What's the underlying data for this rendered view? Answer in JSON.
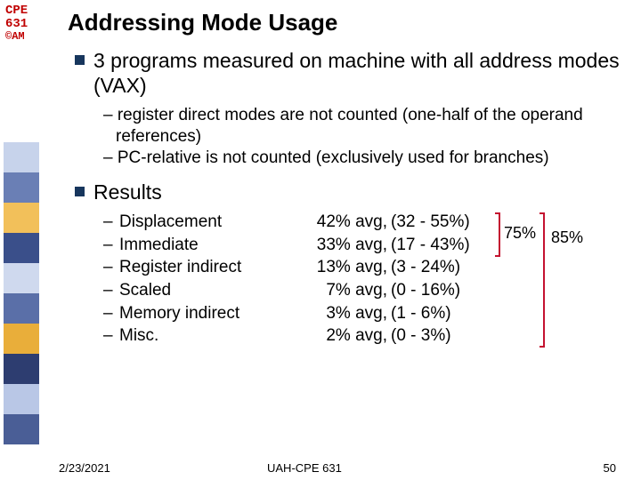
{
  "course": {
    "line1": "CPE",
    "line2": "631",
    "line3": "©AM"
  },
  "title": "Addressing Mode Usage",
  "bullets": {
    "main1": "3 programs measured on machine with all address modes (VAX)",
    "sub1": "register direct modes are not counted (one-half of the operand references)",
    "sub2": "PC-relative is not counted (exclusively used for branches)",
    "main2": "Results"
  },
  "results": [
    {
      "name": "Displacement",
      "avg": "42% avg,",
      "range": "(32 - 55%)"
    },
    {
      "name": "Immediate",
      "avg": "33% avg,",
      "range": "(17 - 43%)"
    },
    {
      "name": "Register indirect",
      "avg": "13% avg,",
      "range": "(3 - 24%)"
    },
    {
      "name": "Scaled",
      "avg": "7% avg,",
      "range": "(0 - 16%)"
    },
    {
      "name": "Memory indirect",
      "avg": "3% avg,",
      "range": "(1 - 6%)"
    },
    {
      "name": "Misc.",
      "avg": "2% avg,",
      "range": "(0 - 3%)"
    }
  ],
  "annotations": {
    "pct75": "75%",
    "pct85": "85%"
  },
  "footer": {
    "date": "2/23/2021",
    "center": "UAH-CPE 631",
    "page": "50"
  }
}
